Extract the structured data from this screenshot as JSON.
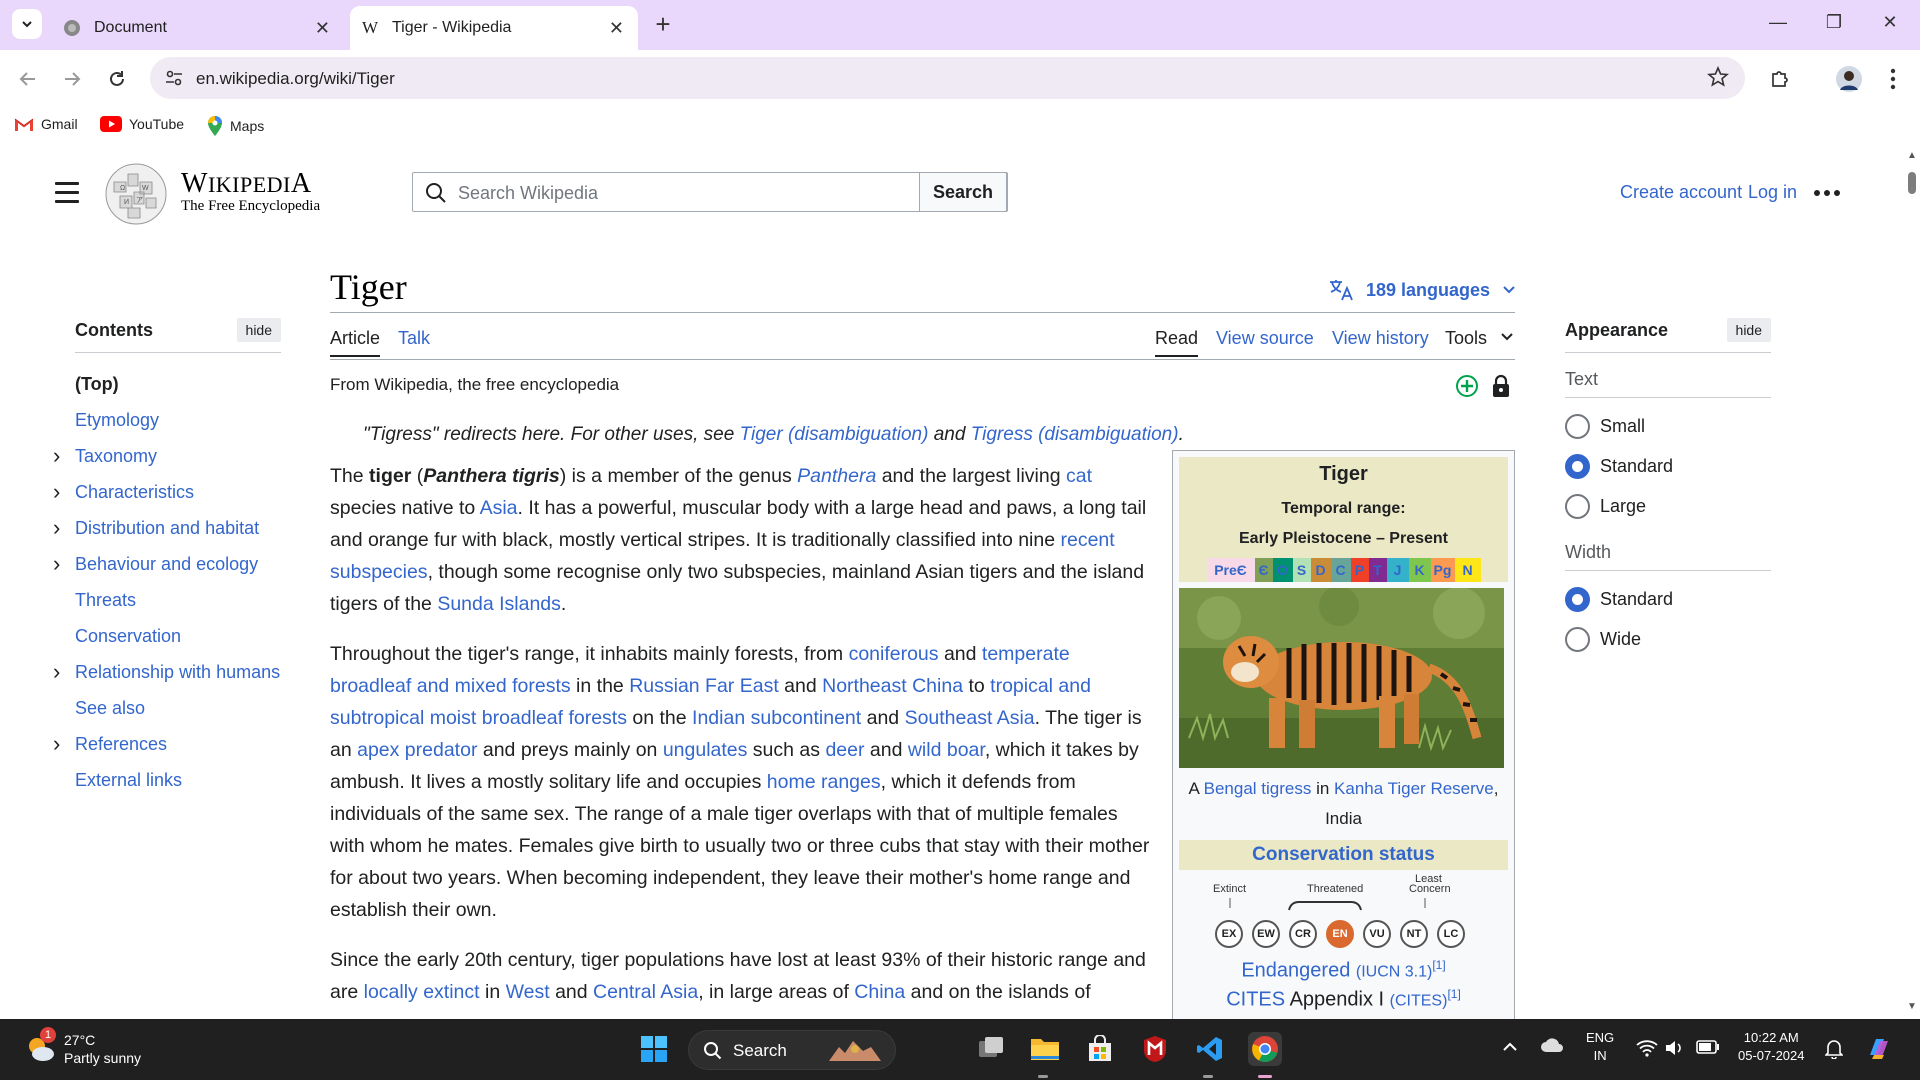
{
  "browser": {
    "tabs": [
      {
        "title": "Document",
        "active": false
      },
      {
        "title": "Tiger - Wikipedia",
        "active": true
      }
    ],
    "url": "en.wikipedia.org/wiki/Tiger",
    "bookmarks": [
      "Gmail",
      "YouTube",
      "Maps"
    ]
  },
  "wiki": {
    "wordmark": "Wikipedia",
    "tagline": "The Free Encyclopedia",
    "search_placeholder": "Search Wikipedia",
    "search_button": "Search",
    "create_account": "Create account",
    "login": "Log in"
  },
  "toc": {
    "title": "Contents",
    "hide": "hide",
    "items": [
      {
        "label": "(Top)",
        "expandable": false
      },
      {
        "label": "Etymology",
        "expandable": false
      },
      {
        "label": "Taxonomy",
        "expandable": true
      },
      {
        "label": "Characteristics",
        "expandable": true
      },
      {
        "label": "Distribution and habitat",
        "expandable": true
      },
      {
        "label": "Behaviour and ecology",
        "expandable": true
      },
      {
        "label": "Threats",
        "expandable": false
      },
      {
        "label": "Conservation",
        "expandable": false
      },
      {
        "label": "Relationship with humans",
        "expandable": true
      },
      {
        "label": "See also",
        "expandable": false
      },
      {
        "label": "References",
        "expandable": true
      },
      {
        "label": "External links",
        "expandable": false
      }
    ]
  },
  "article": {
    "title": "Tiger",
    "languages": "189 languages",
    "tabs_left": [
      "Article",
      "Talk"
    ],
    "tabs_right": [
      "Read",
      "View source",
      "View history",
      "Tools"
    ],
    "from": "From Wikipedia, the free encyclopedia",
    "hatnote": {
      "pre": "\"Tigress\" redirects here. For other uses, see ",
      "link1": "Tiger (disambiguation)",
      "mid": " and ",
      "link2": "Tigress (disambiguation)",
      "post": "."
    },
    "p1": {
      "a": "The ",
      "b": "tiger",
      "c": " (",
      "d": "Panthera tigris",
      "e": ") is a member of the genus ",
      "f": "Panthera",
      "g": " and the largest living ",
      "h": "cat",
      "i": " species native to ",
      "j": "Asia",
      "k": ". It has a powerful, muscular body with a large head and paws, a long tail and orange fur with black, mostly vertical stripes. It is traditionally classified into nine ",
      "l": "recent subspecies",
      "m": ", though some recognise only two subspecies, mainland Asian tigers and the island tigers of the ",
      "n": "Sunda Islands",
      "o": "."
    },
    "p2": {
      "a": "Throughout the tiger's range, it inhabits mainly forests, from ",
      "b": "coniferous",
      "c": " and ",
      "d": "temperate broadleaf and mixed forests",
      "e": " in the ",
      "f": "Russian Far East",
      "g": " and ",
      "h": "Northeast China",
      "i": " to ",
      "j": "tropical and subtropical moist broadleaf forests",
      "k": " on the ",
      "l": "Indian subcontinent",
      "m": " and ",
      "n": "Southeast Asia",
      "o": ". The tiger is an ",
      "p": "apex predator",
      "q": " and preys mainly on ",
      "r": "ungulates",
      "s": " such as ",
      "t": "deer",
      "u": " and ",
      "v": "wild boar",
      "w": ", which it takes by ambush. It lives a mostly solitary life and occupies ",
      "x": "home ranges",
      "y": ", which it defends from individuals of the same sex. The range of a male tiger overlaps with that of multiple females with whom he mates. Females give birth to usually two or three cubs that stay with their mother for about two years. When becoming independent, they leave their mother's home range and establish their own."
    },
    "p3": {
      "a": "Since the early 20th century, tiger populations have lost at least 93% of their historic range and are ",
      "b": "locally extinct",
      "c": " in ",
      "d": "West",
      "e": " and ",
      "f": "Central Asia",
      "g": ", in large areas of ",
      "h": "China",
      "i": " and on the islands of"
    }
  },
  "infobox": {
    "name": "Tiger",
    "temporal_label": "Temporal range:",
    "temporal_value": "Early Pleistocene – Present",
    "timescale": [
      "PreЄ",
      "Є",
      "O",
      "S",
      "D",
      "C",
      "P",
      "T",
      "J",
      "K",
      "Pg",
      "N"
    ],
    "caption_pre": "A ",
    "caption_link1": "Bengal tigress",
    "caption_mid": " in ",
    "caption_link2": "Kanha Tiger Reserve",
    "caption_post": ", India",
    "conservation_header": "Conservation status",
    "scale_labels": {
      "extinct": "Extinct",
      "threatened": "Threatened",
      "least1": "Least",
      "least2": "Concern"
    },
    "scale": [
      "EX",
      "EW",
      "CR",
      "EN",
      "VU",
      "NT",
      "LC"
    ],
    "status": "Endangered",
    "iucn": "(IUCN 3.1)",
    "ref": "[1]",
    "cites": "CITES",
    "cites_text": " Appendix I ",
    "cites_paren": "(CITES)",
    "cites_ref": "[1]"
  },
  "appearance": {
    "title": "Appearance",
    "hide": "hide",
    "text_label": "Text",
    "text_options": [
      "Small",
      "Standard",
      "Large"
    ],
    "text_selected": "Standard",
    "width_label": "Width",
    "width_options": [
      "Standard",
      "Wide"
    ],
    "width_selected": "Standard"
  },
  "taskbar": {
    "temp": "27°C",
    "weather": "Partly sunny",
    "weather_badge": "1",
    "search": "Search",
    "lang1": "ENG",
    "lang2": "IN",
    "time": "10:22 AM",
    "date": "05-07-2024"
  },
  "colors": {
    "link": "#3366cc",
    "tab_strip": "#e9d8fb",
    "en_status": "#d9692e"
  }
}
